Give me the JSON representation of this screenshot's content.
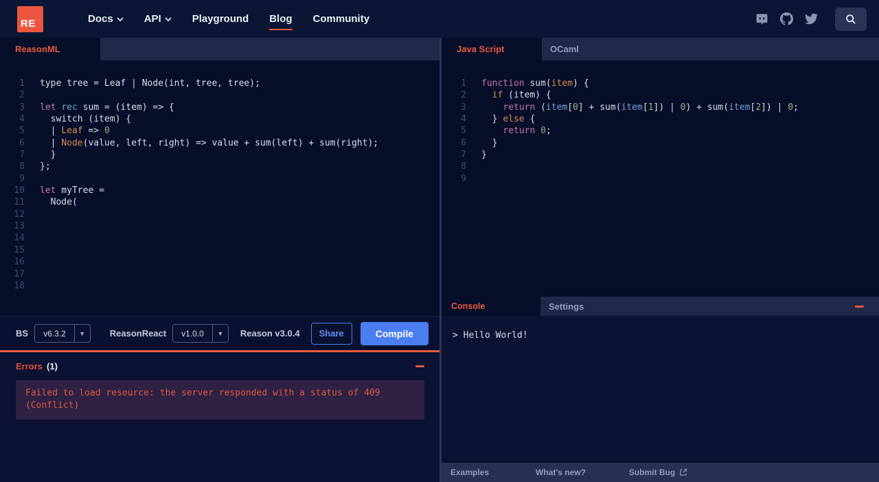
{
  "accent": "#e85a3e",
  "navbar": {
    "logo": "RE",
    "links": [
      {
        "label": "Docs",
        "chevron": true
      },
      {
        "label": "API",
        "chevron": true
      },
      {
        "label": "Playground",
        "chevron": false
      },
      {
        "label": "Blog",
        "chevron": false,
        "active": true
      },
      {
        "label": "Community",
        "chevron": false
      }
    ],
    "icons": [
      "discord-icon",
      "github-icon",
      "twitter-icon",
      "search-icon"
    ]
  },
  "left": {
    "tab_label": "ReasonML",
    "total_lines": 18,
    "code": [
      [
        [
          "p",
          "type tree = Leaf | Node(int, tree, tree);"
        ]
      ],
      [],
      [
        [
          "k",
          "let"
        ],
        [
          "p",
          " "
        ],
        [
          "b",
          "rec"
        ],
        [
          "p",
          " sum = (item) => {"
        ]
      ],
      [
        [
          "p",
          "  switch (item) {"
        ]
      ],
      [
        [
          "p",
          "  | "
        ],
        [
          "o",
          "Leaf"
        ],
        [
          "p",
          " => "
        ],
        [
          "g",
          "0"
        ]
      ],
      [
        [
          "p",
          "  | "
        ],
        [
          "o",
          "Node"
        ],
        [
          "p",
          "(value, left, right) => value + sum(left) + sum(right);"
        ]
      ],
      [
        [
          "p",
          "  }"
        ]
      ],
      [
        [
          "p",
          "};"
        ]
      ],
      [],
      [
        [
          "k",
          "let"
        ],
        [
          "p",
          " myTree ="
        ]
      ],
      [
        [
          "p",
          "  Node("
        ]
      ],
      [],
      [],
      [],
      [],
      [],
      [],
      []
    ],
    "controls": {
      "bs_label": "BS",
      "bs_version": "v6.3.2",
      "reasonreact_label": "ReasonReact",
      "reasonreact_version": "v1.0.0",
      "reason_version": "Reason v3.0.4",
      "share_label": "Share",
      "compile_label": "Compile",
      "caret": "▼"
    },
    "errors": {
      "title": "Errors",
      "count": "(1)",
      "message": "Failed to load resource: the server responded with a status of 409 (Conflict)"
    }
  },
  "right": {
    "tabs": {
      "active_label": "Java Script",
      "inactive_label": "OCaml"
    },
    "total_lines": 9,
    "code": [
      [
        [
          "k",
          "function"
        ],
        [
          "p",
          " sum("
        ],
        [
          "o",
          "item"
        ],
        [
          "p",
          ") {"
        ]
      ],
      [
        [
          "p",
          "  "
        ],
        [
          "o",
          "if"
        ],
        [
          "p",
          " (item) {"
        ]
      ],
      [
        [
          "p",
          "    "
        ],
        [
          "k",
          "return"
        ],
        [
          "p",
          " ("
        ],
        [
          "b",
          "item"
        ],
        [
          "p",
          "["
        ],
        [
          "g",
          "0"
        ],
        [
          "p",
          "] + sum("
        ],
        [
          "b",
          "item"
        ],
        [
          "p",
          "["
        ],
        [
          "g",
          "1"
        ],
        [
          "p",
          "]) | "
        ],
        [
          "g",
          "0"
        ],
        [
          "p",
          ") + sum("
        ],
        [
          "b",
          "item"
        ],
        [
          "p",
          "["
        ],
        [
          "g",
          "2"
        ],
        [
          "p",
          "]) | "
        ],
        [
          "g",
          "0"
        ],
        [
          "p",
          ";"
        ]
      ],
      [
        [
          "p",
          "  } "
        ],
        [
          "o",
          "else"
        ],
        [
          "p",
          " {"
        ]
      ],
      [
        [
          "p",
          "    "
        ],
        [
          "k",
          "return"
        ],
        [
          "p",
          " "
        ],
        [
          "g",
          "0"
        ],
        [
          "p",
          ";"
        ]
      ],
      [
        [
          "p",
          "  }"
        ]
      ],
      [
        [
          "p",
          "}"
        ]
      ],
      [],
      []
    ],
    "console": {
      "active_tab": "Console",
      "inactive_tab": "Settings",
      "output": "> Hello World!",
      "footer": [
        "Examples",
        "What's new?",
        "Submit Bug"
      ]
    }
  }
}
